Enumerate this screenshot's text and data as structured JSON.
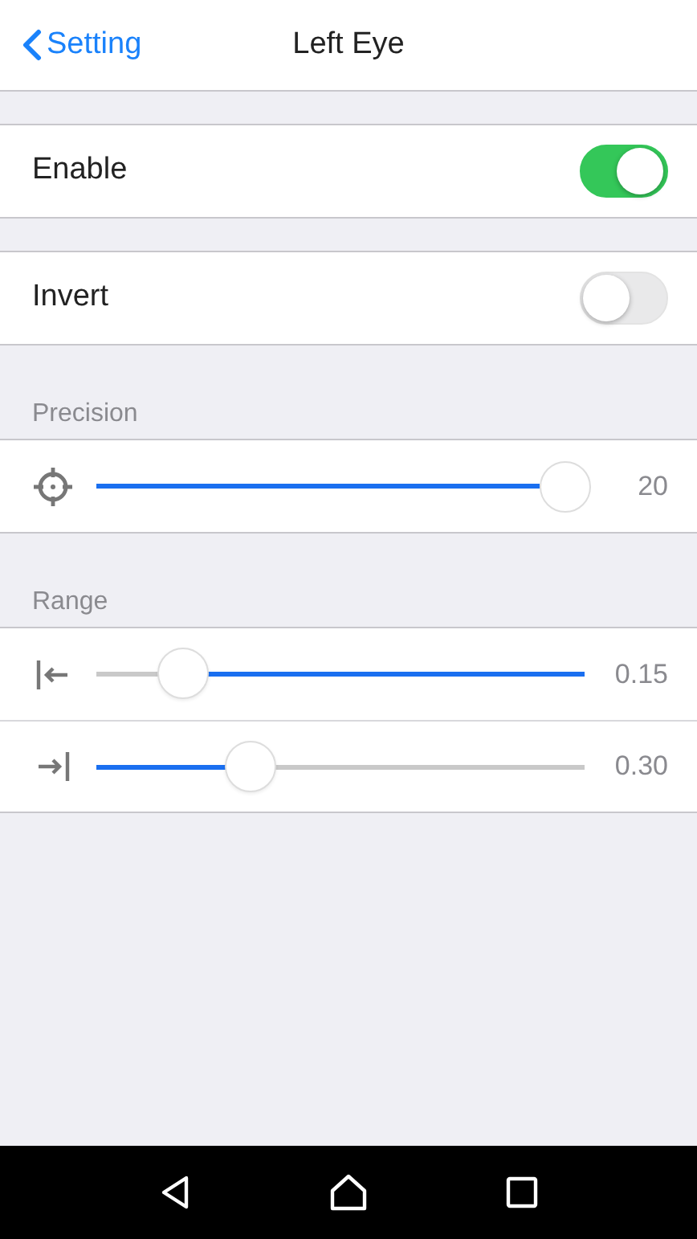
{
  "header": {
    "back_label": "Setting",
    "title": "Left Eye"
  },
  "sections": [
    {
      "rows": [
        {
          "kind": "toggle",
          "label": "Enable",
          "on": true
        }
      ]
    },
    {
      "rows": [
        {
          "kind": "toggle",
          "label": "Invert",
          "on": false
        }
      ]
    },
    {
      "title": "Precision",
      "rows": [
        {
          "kind": "max_slider",
          "reading": "20"
        }
      ]
    },
    {
      "title": "Range",
      "rows": [
        {
          "kind": "min_slider",
          "reading": "0.15"
        },
        {
          "kind": "slider",
          "level": 0.315,
          "reading": "0.30"
        }
      ]
    }
  ]
}
